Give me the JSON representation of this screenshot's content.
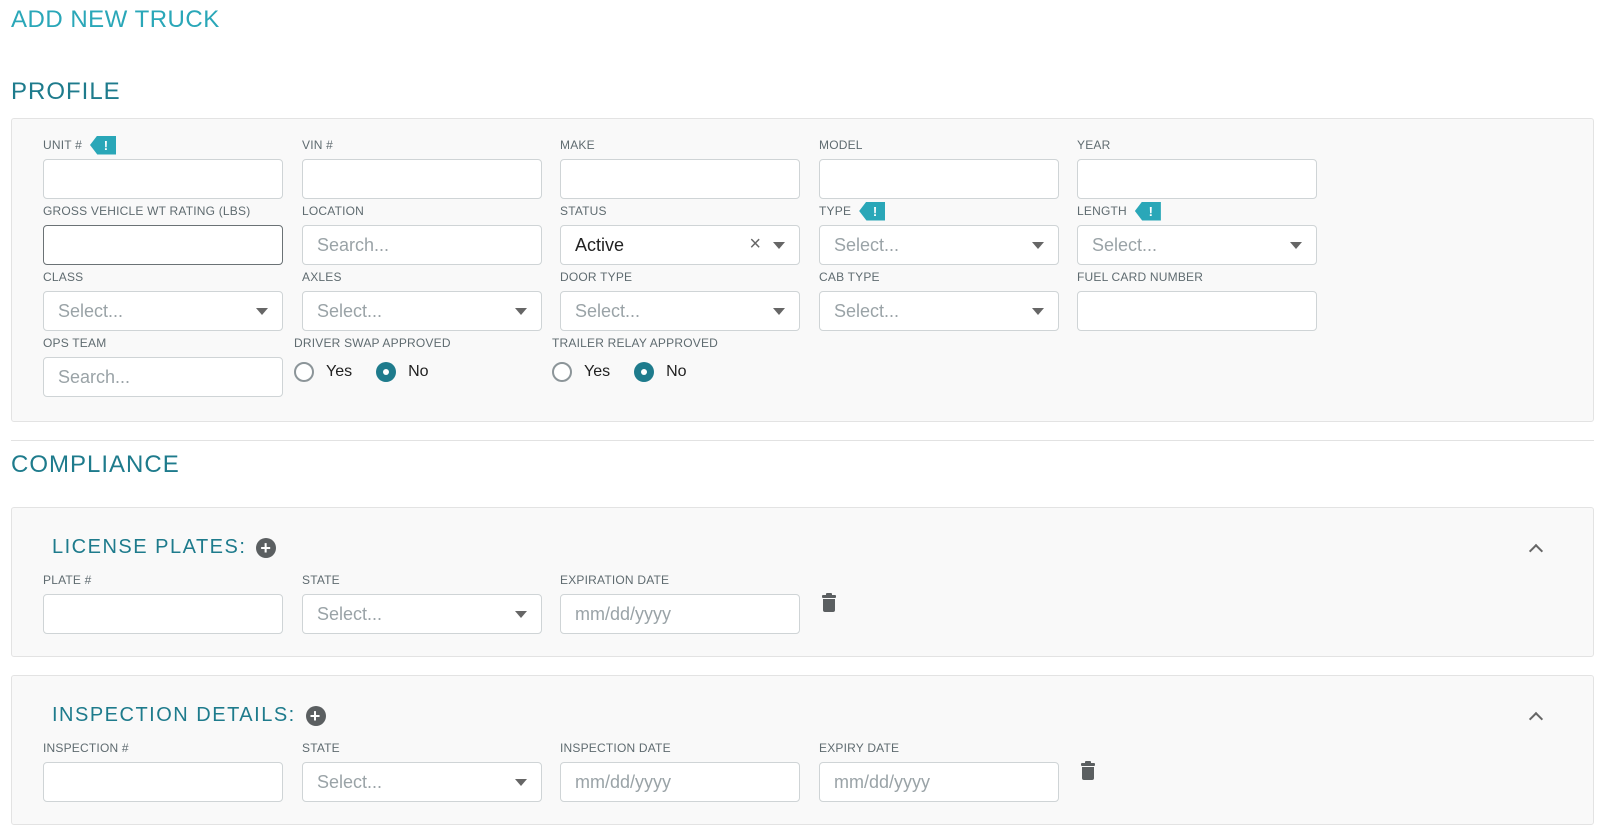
{
  "page": {
    "title": "ADD NEW TRUCK"
  },
  "profile": {
    "title": "PROFILE",
    "unit": {
      "label": "UNIT #",
      "value": ""
    },
    "vin": {
      "label": "VIN #",
      "value": ""
    },
    "make": {
      "label": "MAKE",
      "value": ""
    },
    "model": {
      "label": "MODEL",
      "value": ""
    },
    "year": {
      "label": "YEAR",
      "value": ""
    },
    "gvwr": {
      "label": "GROSS VEHICLE WT RATING (LBS)",
      "value": ""
    },
    "location": {
      "label": "LOCATION",
      "placeholder": "Search..."
    },
    "status": {
      "label": "STATUS",
      "value": "Active"
    },
    "type": {
      "label": "TYPE",
      "placeholder": "Select..."
    },
    "length": {
      "label": "LENGTH",
      "placeholder": "Select..."
    },
    "class": {
      "label": "CLASS",
      "placeholder": "Select..."
    },
    "axles": {
      "label": "AXLES",
      "placeholder": "Select..."
    },
    "door_type": {
      "label": "DOOR TYPE",
      "placeholder": "Select..."
    },
    "cab_type": {
      "label": "CAB TYPE",
      "placeholder": "Select..."
    },
    "fuel_card": {
      "label": "FUEL CARD NUMBER",
      "value": ""
    },
    "ops_team": {
      "label": "OPS TEAM",
      "placeholder": "Search..."
    },
    "driver_swap": {
      "label": "DRIVER SWAP APPROVED",
      "yes": "Yes",
      "no": "No",
      "selected": "No"
    },
    "trailer_relay": {
      "label": "TRAILER RELAY APPROVED",
      "yes": "Yes",
      "no": "No",
      "selected": "No"
    },
    "required_marker": "!"
  },
  "compliance": {
    "title": "COMPLIANCE",
    "license_plates": {
      "title": "LICENSE PLATES:",
      "plate": {
        "label": "PLATE #",
        "value": ""
      },
      "state": {
        "label": "STATE",
        "placeholder": "Select..."
      },
      "expiration": {
        "label": "EXPIRATION DATE",
        "placeholder": "mm/dd/yyyy"
      }
    },
    "inspection": {
      "title": "INSPECTION DETAILS:",
      "number": {
        "label": "INSPECTION #",
        "value": ""
      },
      "state": {
        "label": "STATE",
        "placeholder": "Select..."
      },
      "inspection_date": {
        "label": "INSPECTION DATE",
        "placeholder": "mm/dd/yyyy"
      },
      "expiry_date": {
        "label": "EXPIRY DATE",
        "placeholder": "mm/dd/yyyy"
      }
    }
  },
  "icons": {
    "add": "plus-circle-icon",
    "collapse": "chevron-up-icon",
    "delete": "trash-icon",
    "clear": "close-icon",
    "dropdown": "caret-down-icon"
  },
  "colors": {
    "accent": "#2aa7b8",
    "section": "#1e7b8c",
    "panel_bg": "#f9f9f9"
  }
}
